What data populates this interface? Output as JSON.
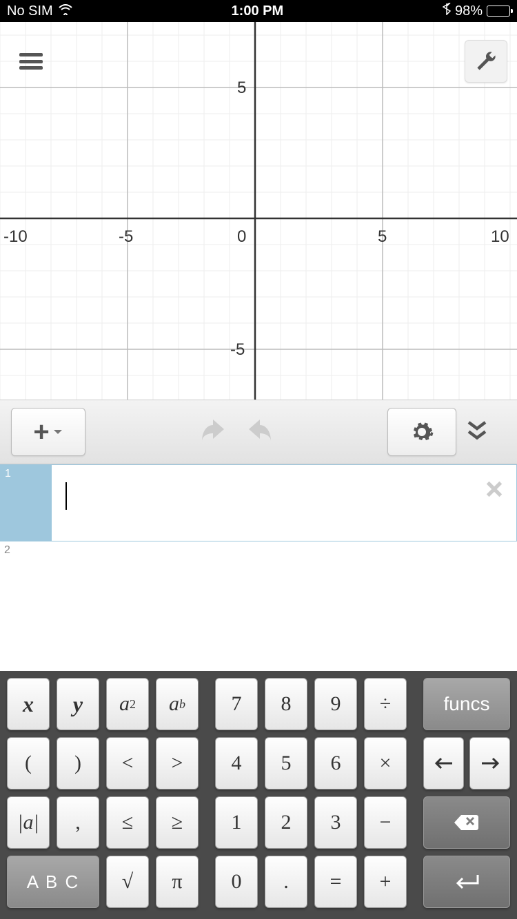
{
  "status": {
    "carrier": "No SIM",
    "time": "1:00 PM",
    "battery": "98%"
  },
  "graph": {
    "x_ticks": [
      "-10",
      "-5",
      "0",
      "5",
      "10"
    ],
    "y_ticks_pos": "5",
    "y_ticks_neg": "-5"
  },
  "expressions": {
    "row1_num": "1",
    "row1_value": "",
    "row2_num": "2"
  },
  "keypad": {
    "x": "x",
    "y": "y",
    "asq_base": "a",
    "asq_sup": "2",
    "apw_base": "a",
    "apw_sup": "b",
    "lp": "(",
    "rp": ")",
    "lt": "<",
    "gt": ">",
    "abs": "|a|",
    "comma": ",",
    "le": "≤",
    "ge": "≥",
    "abc": "A B C",
    "sqrt": "√",
    "pi": "π",
    "n7": "7",
    "n8": "8",
    "n9": "9",
    "div": "÷",
    "n4": "4",
    "n5": "5",
    "n6": "6",
    "mul": "×",
    "n1": "1",
    "n2": "2",
    "n3": "3",
    "sub": "−",
    "n0": "0",
    "dot": ".",
    "eq": "=",
    "add": "+",
    "funcs": "funcs",
    "left": "←",
    "right": "→",
    "bksp": "⌫",
    "enter": "↵"
  }
}
